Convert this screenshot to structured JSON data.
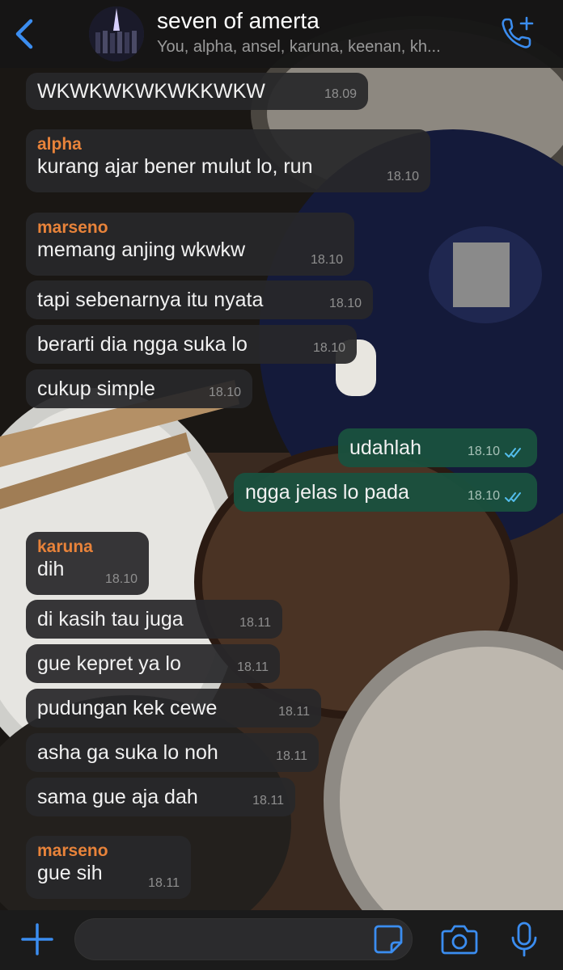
{
  "header": {
    "title": "seven of amerta",
    "subtitle": "You, alpha, ansel, karuna, keenan, kh...",
    "back_icon": "chevron-left-icon",
    "call_icon": "phone-add-icon"
  },
  "colors": {
    "accent": "#3b8df0",
    "sender_name": "#e8833a",
    "incoming_bubble": "#28282a",
    "outgoing_bubble": "#1a503e",
    "read_ticks": "#53bdeb"
  },
  "messages": [
    {
      "direction": "in",
      "sender": "",
      "text": "WKWKWKWKWKKWKW",
      "time": "18.09"
    },
    {
      "direction": "in",
      "sender": "alpha",
      "text": "kurang ajar bener mulut lo, run",
      "time": "18.10"
    },
    {
      "direction": "in",
      "sender": "marseno",
      "text": "memang anjing wkwkw",
      "time": "18.10"
    },
    {
      "direction": "in",
      "sender": "",
      "text": "tapi sebenarnya itu nyata",
      "time": "18.10"
    },
    {
      "direction": "in",
      "sender": "",
      "text": "berarti dia ngga suka lo",
      "time": "18.10"
    },
    {
      "direction": "in",
      "sender": "",
      "text": "cukup simple",
      "time": "18.10"
    },
    {
      "direction": "out",
      "sender": "",
      "text": "udahlah",
      "time": "18.10",
      "status": "read"
    },
    {
      "direction": "out",
      "sender": "",
      "text": "ngga jelas lo pada",
      "time": "18.10",
      "status": "read"
    },
    {
      "direction": "in",
      "sender": "karuna",
      "text": "dih",
      "time": "18.10"
    },
    {
      "direction": "in",
      "sender": "",
      "text": "di kasih tau juga",
      "time": "18.11"
    },
    {
      "direction": "in",
      "sender": "",
      "text": "gue kepret ya lo",
      "time": "18.11"
    },
    {
      "direction": "in",
      "sender": "",
      "text": "pudungan kek cewe",
      "time": "18.11"
    },
    {
      "direction": "in",
      "sender": "",
      "text": "asha ga suka lo noh",
      "time": "18.11"
    },
    {
      "direction": "in",
      "sender": "",
      "text": "sama gue aja dah",
      "time": "18.11"
    },
    {
      "direction": "in",
      "sender": "marseno",
      "text": "gue sih",
      "time": "18.11"
    }
  ],
  "composer": {
    "value": "",
    "plus_icon": "plus-icon",
    "sticker_icon": "sticker-icon",
    "camera_icon": "camera-icon",
    "mic_icon": "microphone-icon"
  }
}
